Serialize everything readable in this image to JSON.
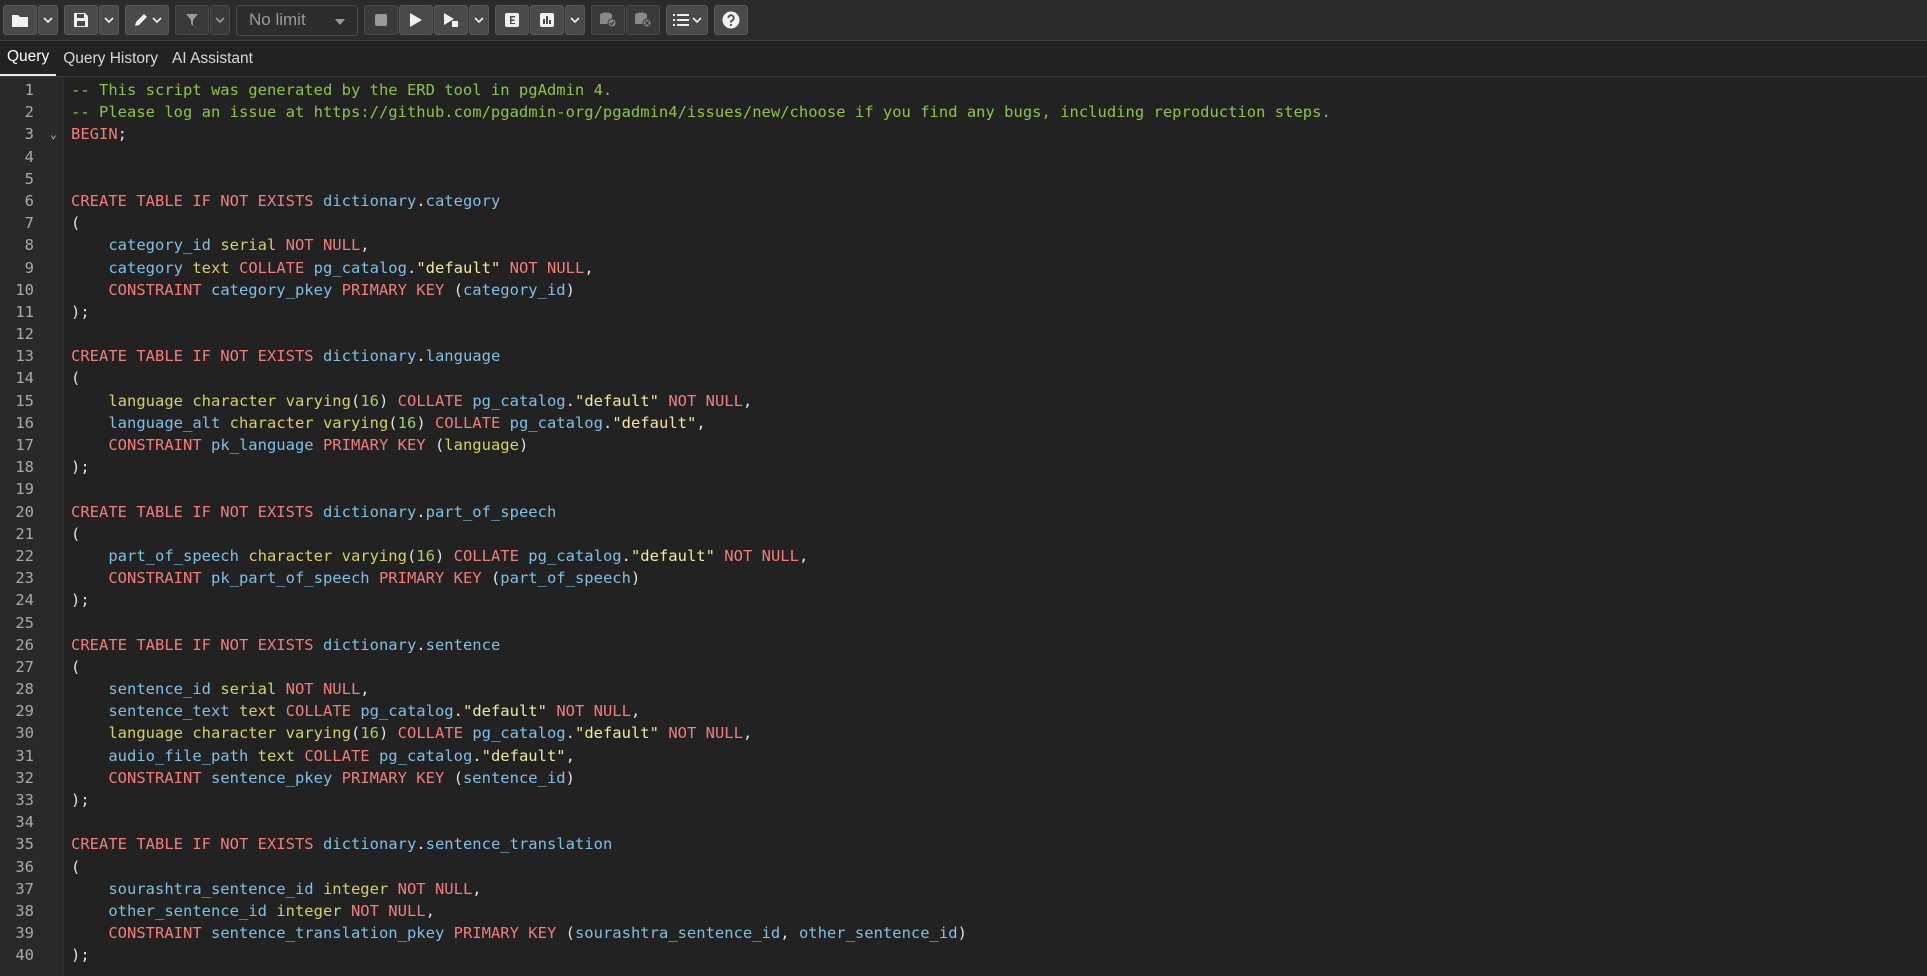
{
  "toolbar": {
    "limit_value": "No limit",
    "icons": [
      "folder-open-icon",
      "save-icon",
      "edit-pen-icon",
      "filter-icon",
      "stop-icon",
      "execute-icon",
      "execute-script-icon",
      "explain-icon",
      "explain-analyze-icon",
      "commit-icon",
      "rollback-icon",
      "macros-icon",
      "help-icon"
    ]
  },
  "tabs": [
    {
      "label": "Query",
      "active": true
    },
    {
      "label": "Query History",
      "active": false
    },
    {
      "label": "AI Assistant",
      "active": false
    }
  ],
  "editor": {
    "lines": [
      [
        [
          "cm",
          "-- This script was generated by the ERD tool in pgAdmin 4."
        ]
      ],
      [
        [
          "cm",
          "-- Please log an issue at https://github.com/pgadmin-org/pgadmin4/issues/new/choose if you find any bugs, including reproduction steps."
        ]
      ],
      [
        [
          "kw",
          "BEGIN"
        ],
        [
          "pu",
          ";"
        ]
      ],
      [],
      [],
      [
        [
          "kw",
          "CREATE TABLE IF NOT EXISTS "
        ],
        [
          "id",
          "dictionary"
        ],
        [
          "pu",
          "."
        ],
        [
          "id",
          "category"
        ]
      ],
      [
        [
          "pu",
          "("
        ]
      ],
      [
        [
          "pu",
          "    "
        ],
        [
          "id",
          "category_id "
        ],
        [
          "ty",
          "serial "
        ],
        [
          "kw",
          "NOT NULL"
        ],
        [
          "pu",
          ","
        ]
      ],
      [
        [
          "pu",
          "    "
        ],
        [
          "id",
          "category "
        ],
        [
          "ty",
          "text "
        ],
        [
          "kw",
          "COLLATE "
        ],
        [
          "id",
          "pg_catalog"
        ],
        [
          "pu",
          "."
        ],
        [
          "st",
          "\"default\" "
        ],
        [
          "kw",
          "NOT NULL"
        ],
        [
          "pu",
          ","
        ]
      ],
      [
        [
          "pu",
          "    "
        ],
        [
          "kw",
          "CONSTRAINT "
        ],
        [
          "id",
          "category_pkey "
        ],
        [
          "kw",
          "PRIMARY KEY "
        ],
        [
          "pu",
          "("
        ],
        [
          "id",
          "category_id"
        ],
        [
          "pu",
          ")"
        ]
      ],
      [
        [
          "pu",
          ");"
        ]
      ],
      [],
      [
        [
          "kw",
          "CREATE TABLE IF NOT EXISTS "
        ],
        [
          "id",
          "dictionary"
        ],
        [
          "pu",
          "."
        ],
        [
          "id",
          "language"
        ]
      ],
      [
        [
          "pu",
          "("
        ]
      ],
      [
        [
          "pu",
          "    "
        ],
        [
          "ty",
          "language character varying"
        ],
        [
          "pu",
          "("
        ],
        [
          "nm",
          "16"
        ],
        [
          "pu",
          ") "
        ],
        [
          "kw",
          "COLLATE "
        ],
        [
          "id",
          "pg_catalog"
        ],
        [
          "pu",
          "."
        ],
        [
          "st",
          "\"default\" "
        ],
        [
          "kw",
          "NOT NULL"
        ],
        [
          "pu",
          ","
        ]
      ],
      [
        [
          "pu",
          "    "
        ],
        [
          "id",
          "language_alt "
        ],
        [
          "ty",
          "character varying"
        ],
        [
          "pu",
          "("
        ],
        [
          "nm",
          "16"
        ],
        [
          "pu",
          ") "
        ],
        [
          "kw",
          "COLLATE "
        ],
        [
          "id",
          "pg_catalog"
        ],
        [
          "pu",
          "."
        ],
        [
          "st",
          "\"default\""
        ],
        [
          "pu",
          ","
        ]
      ],
      [
        [
          "pu",
          "    "
        ],
        [
          "kw",
          "CONSTRAINT "
        ],
        [
          "id",
          "pk_language "
        ],
        [
          "kw",
          "PRIMARY KEY "
        ],
        [
          "pu",
          "("
        ],
        [
          "ty",
          "language"
        ],
        [
          "pu",
          ")"
        ]
      ],
      [
        [
          "pu",
          ");"
        ]
      ],
      [],
      [
        [
          "kw",
          "CREATE TABLE IF NOT EXISTS "
        ],
        [
          "id",
          "dictionary"
        ],
        [
          "pu",
          "."
        ],
        [
          "id",
          "part_of_speech"
        ]
      ],
      [
        [
          "pu",
          "("
        ]
      ],
      [
        [
          "pu",
          "    "
        ],
        [
          "id",
          "part_of_speech "
        ],
        [
          "ty",
          "character varying"
        ],
        [
          "pu",
          "("
        ],
        [
          "nm",
          "16"
        ],
        [
          "pu",
          ") "
        ],
        [
          "kw",
          "COLLATE "
        ],
        [
          "id",
          "pg_catalog"
        ],
        [
          "pu",
          "."
        ],
        [
          "st",
          "\"default\" "
        ],
        [
          "kw",
          "NOT NULL"
        ],
        [
          "pu",
          ","
        ]
      ],
      [
        [
          "pu",
          "    "
        ],
        [
          "kw",
          "CONSTRAINT "
        ],
        [
          "id",
          "pk_part_of_speech "
        ],
        [
          "kw",
          "PRIMARY KEY "
        ],
        [
          "pu",
          "("
        ],
        [
          "id",
          "part_of_speech"
        ],
        [
          "pu",
          ")"
        ]
      ],
      [
        [
          "pu",
          ");"
        ]
      ],
      [],
      [
        [
          "kw",
          "CREATE TABLE IF NOT EXISTS "
        ],
        [
          "id",
          "dictionary"
        ],
        [
          "pu",
          "."
        ],
        [
          "id",
          "sentence"
        ]
      ],
      [
        [
          "pu",
          "("
        ]
      ],
      [
        [
          "pu",
          "    "
        ],
        [
          "id",
          "sentence_id "
        ],
        [
          "ty",
          "serial "
        ],
        [
          "kw",
          "NOT NULL"
        ],
        [
          "pu",
          ","
        ]
      ],
      [
        [
          "pu",
          "    "
        ],
        [
          "id",
          "sentence_text "
        ],
        [
          "ty",
          "text "
        ],
        [
          "kw",
          "COLLATE "
        ],
        [
          "id",
          "pg_catalog"
        ],
        [
          "pu",
          "."
        ],
        [
          "st",
          "\"default\" "
        ],
        [
          "kw",
          "NOT NULL"
        ],
        [
          "pu",
          ","
        ]
      ],
      [
        [
          "pu",
          "    "
        ],
        [
          "ty",
          "language character varying"
        ],
        [
          "pu",
          "("
        ],
        [
          "nm",
          "16"
        ],
        [
          "pu",
          ") "
        ],
        [
          "kw",
          "COLLATE "
        ],
        [
          "id",
          "pg_catalog"
        ],
        [
          "pu",
          "."
        ],
        [
          "st",
          "\"default\" "
        ],
        [
          "kw",
          "NOT NULL"
        ],
        [
          "pu",
          ","
        ]
      ],
      [
        [
          "pu",
          "    "
        ],
        [
          "id",
          "audio_file_path "
        ],
        [
          "ty",
          "text "
        ],
        [
          "kw",
          "COLLATE "
        ],
        [
          "id",
          "pg_catalog"
        ],
        [
          "pu",
          "."
        ],
        [
          "st",
          "\"default\""
        ],
        [
          "pu",
          ","
        ]
      ],
      [
        [
          "pu",
          "    "
        ],
        [
          "kw",
          "CONSTRAINT "
        ],
        [
          "id",
          "sentence_pkey "
        ],
        [
          "kw",
          "PRIMARY KEY "
        ],
        [
          "pu",
          "("
        ],
        [
          "id",
          "sentence_id"
        ],
        [
          "pu",
          ")"
        ]
      ],
      [
        [
          "pu",
          ");"
        ]
      ],
      [],
      [
        [
          "kw",
          "CREATE TABLE IF NOT EXISTS "
        ],
        [
          "id",
          "dictionary"
        ],
        [
          "pu",
          "."
        ],
        [
          "id",
          "sentence_translation"
        ]
      ],
      [
        [
          "pu",
          "("
        ]
      ],
      [
        [
          "pu",
          "    "
        ],
        [
          "id",
          "sourashtra_sentence_id "
        ],
        [
          "ty",
          "integer "
        ],
        [
          "kw",
          "NOT NULL"
        ],
        [
          "pu",
          ","
        ]
      ],
      [
        [
          "pu",
          "    "
        ],
        [
          "id",
          "other_sentence_id "
        ],
        [
          "ty",
          "integer "
        ],
        [
          "kw",
          "NOT NULL"
        ],
        [
          "pu",
          ","
        ]
      ],
      [
        [
          "pu",
          "    "
        ],
        [
          "kw",
          "CONSTRAINT "
        ],
        [
          "id",
          "sentence_translation_pkey "
        ],
        [
          "kw",
          "PRIMARY KEY "
        ],
        [
          "pu",
          "("
        ],
        [
          "id",
          "sourashtra_sentence_id"
        ],
        [
          "pu",
          ", "
        ],
        [
          "id",
          "other_sentence_id"
        ],
        [
          "pu",
          ")"
        ]
      ],
      [
        [
          "pu",
          ");"
        ]
      ]
    ]
  }
}
